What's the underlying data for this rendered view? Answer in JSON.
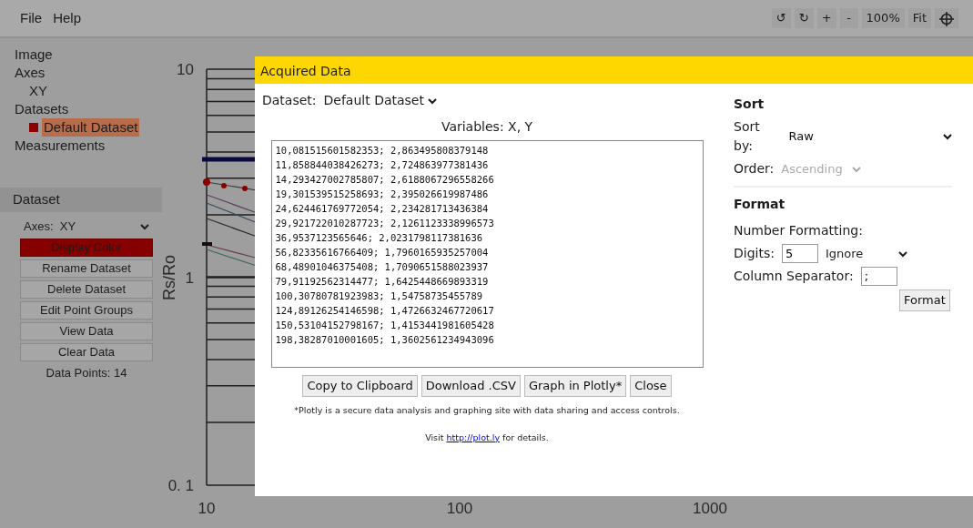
{
  "menu": [
    "File",
    "Help"
  ],
  "toolbar": [
    {
      "kind": "glyph",
      "label": "↺"
    },
    {
      "kind": "glyph",
      "label": "↻"
    },
    {
      "kind": "glyph",
      "label": "+"
    },
    {
      "kind": "glyph",
      "label": "-"
    },
    {
      "kind": "glyph",
      "label": "100%"
    },
    {
      "kind": "glyph",
      "label": "Fit"
    },
    {
      "kind": "crosshair"
    }
  ],
  "sidebar": {
    "items": [
      {
        "label": "Image"
      },
      {
        "label": "Axes",
        "children": [
          {
            "label": "XY",
            "selected": false
          }
        ]
      },
      {
        "label": "Datasets",
        "children": [
          {
            "label": "Default Dataset",
            "selected": true,
            "color": "#8b0000"
          }
        ]
      },
      {
        "label": "Measurements"
      }
    ]
  },
  "dataset_panel": {
    "title": "Dataset",
    "axes_label": "Axes:",
    "axes_value": "XY",
    "buttons": [
      {
        "label": "Display Color",
        "kind": "color"
      },
      {
        "label": "Rename Dataset",
        "kind": "plain"
      },
      {
        "label": "Delete Dataset",
        "kind": "plain"
      },
      {
        "label": "Edit Point Groups",
        "kind": "plain"
      },
      {
        "label": "View Data",
        "kind": "plain"
      },
      {
        "label": "Clear Data",
        "kind": "plain"
      }
    ],
    "data_points": "Data Points: 14"
  },
  "plot": {
    "y_label": "Rs/Ro",
    "y_ticks": [
      "10",
      "1",
      "0. 1"
    ],
    "x_ticks": [
      "10",
      "100",
      "1000"
    ]
  },
  "dialog": {
    "title": "Acquired Data",
    "dataset_label": "Dataset:",
    "dataset_value": "Default Dataset",
    "variables": "Variables: X, Y",
    "rows": [
      "10,081515601582353; 2,863495808379148",
      "11,858844038426273; 2,724863977381436",
      "14,293427002785807; 2,6188067296558266",
      "19,301539515258693; 2,395026619987486",
      "24,624461769772054; 2,234281713436384",
      "29,921722010287723; 2,1261123338996573",
      "36,9537123565646; 2,0231798117381636",
      "56,82335616766409; 1,7960165935257004",
      "68,48901046375408; 1,7090651588023937",
      "79,91192562314477; 1,6425448669893319",
      "100,30780781923983; 1,54758735455789",
      "124,89126254146598; 1,4726632467720617",
      "150,53104152798167; 1,4153441981605428",
      "198,38287010001605; 1,3602561234943096"
    ],
    "buttons": [
      "Copy to Clipboard",
      "Download .CSV",
      "Graph in Plotly*",
      "Close"
    ],
    "note": "*Plotly is a secure data analysis and graphing site with data sharing and access controls.",
    "visit": {
      "before": "Visit",
      "link": "http://plot.ly",
      "after": "for details."
    },
    "sort": {
      "heading": "Sort",
      "sort_by_label": "Sort by:",
      "sort_by_value": "Raw",
      "order_label": "Order:",
      "order_value": "Ascending",
      "order_disabled": true
    },
    "format": {
      "heading": "Format",
      "number_formatting": "Number Formatting:",
      "digits_label": "Digits:",
      "digits_value": "5",
      "mode": "Ignore",
      "separator_label": "Column Separator:",
      "separator_value": ";",
      "button": "Format"
    }
  }
}
